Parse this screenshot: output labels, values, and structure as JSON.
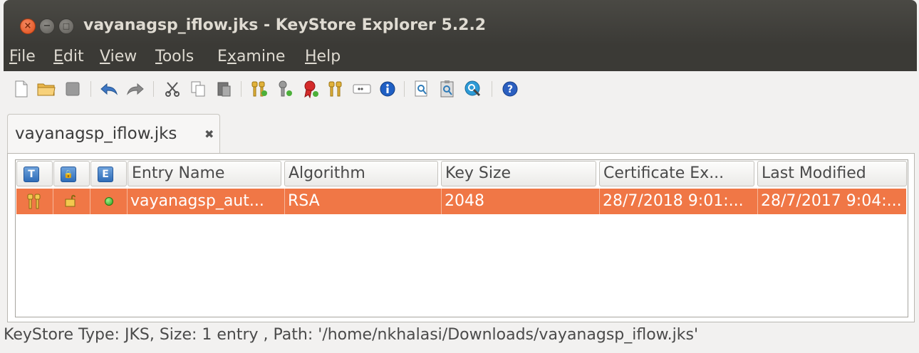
{
  "window": {
    "title": "vayanagsp_iflow.jks - KeyStore Explorer 5.2.2",
    "controls": [
      "close",
      "minimize",
      "maximize"
    ]
  },
  "menubar": {
    "items": [
      {
        "first": "F",
        "rest": "ile"
      },
      {
        "first": "E",
        "rest": "dit"
      },
      {
        "first": "V",
        "rest": "iew"
      },
      {
        "first": "T",
        "rest": "ools"
      },
      {
        "pre": "E",
        "first": "x",
        "rest": "amine"
      },
      {
        "first": "H",
        "rest": "elp"
      }
    ]
  },
  "toolbar": {
    "icons": [
      "new-icon",
      "open-icon",
      "save-icon",
      "undo-icon",
      "redo-icon",
      "cut-icon",
      "copy-icon",
      "paste-icon",
      "generate-keypair-icon",
      "generate-secret-key-icon",
      "import-trusted-cert-icon",
      "import-keypair-icon",
      "set-password-icon",
      "properties-icon",
      "examine-file-icon",
      "examine-clipboard-icon",
      "examine-ssl-icon",
      "help-icon"
    ]
  },
  "tab": {
    "label": "vayanagsp_iflow.jks",
    "close_glyph": "✖"
  },
  "table": {
    "header_icons": [
      "T",
      "🔒",
      "E"
    ],
    "columns": [
      "Entry Name",
      "Algorithm",
      "Key Size",
      "Certificate Ex...",
      "Last Modified"
    ],
    "rows": [
      {
        "entry_name": "vayanagsp_aut...",
        "algorithm": "RSA",
        "key_size": "2048",
        "cert_expiry": "28/7/2018 9:01:...",
        "last_modified": "28/7/2017 9:04:..."
      }
    ]
  },
  "status": {
    "text": "KeyStore Type: JKS, Size: 1 entry , Path: '/home/nkhalasi/Downloads/vayanagsp_iflow.jks'"
  },
  "colors": {
    "titlebar": "#3b3a36",
    "selection": "#f07746",
    "close_button": "#df4b16"
  }
}
